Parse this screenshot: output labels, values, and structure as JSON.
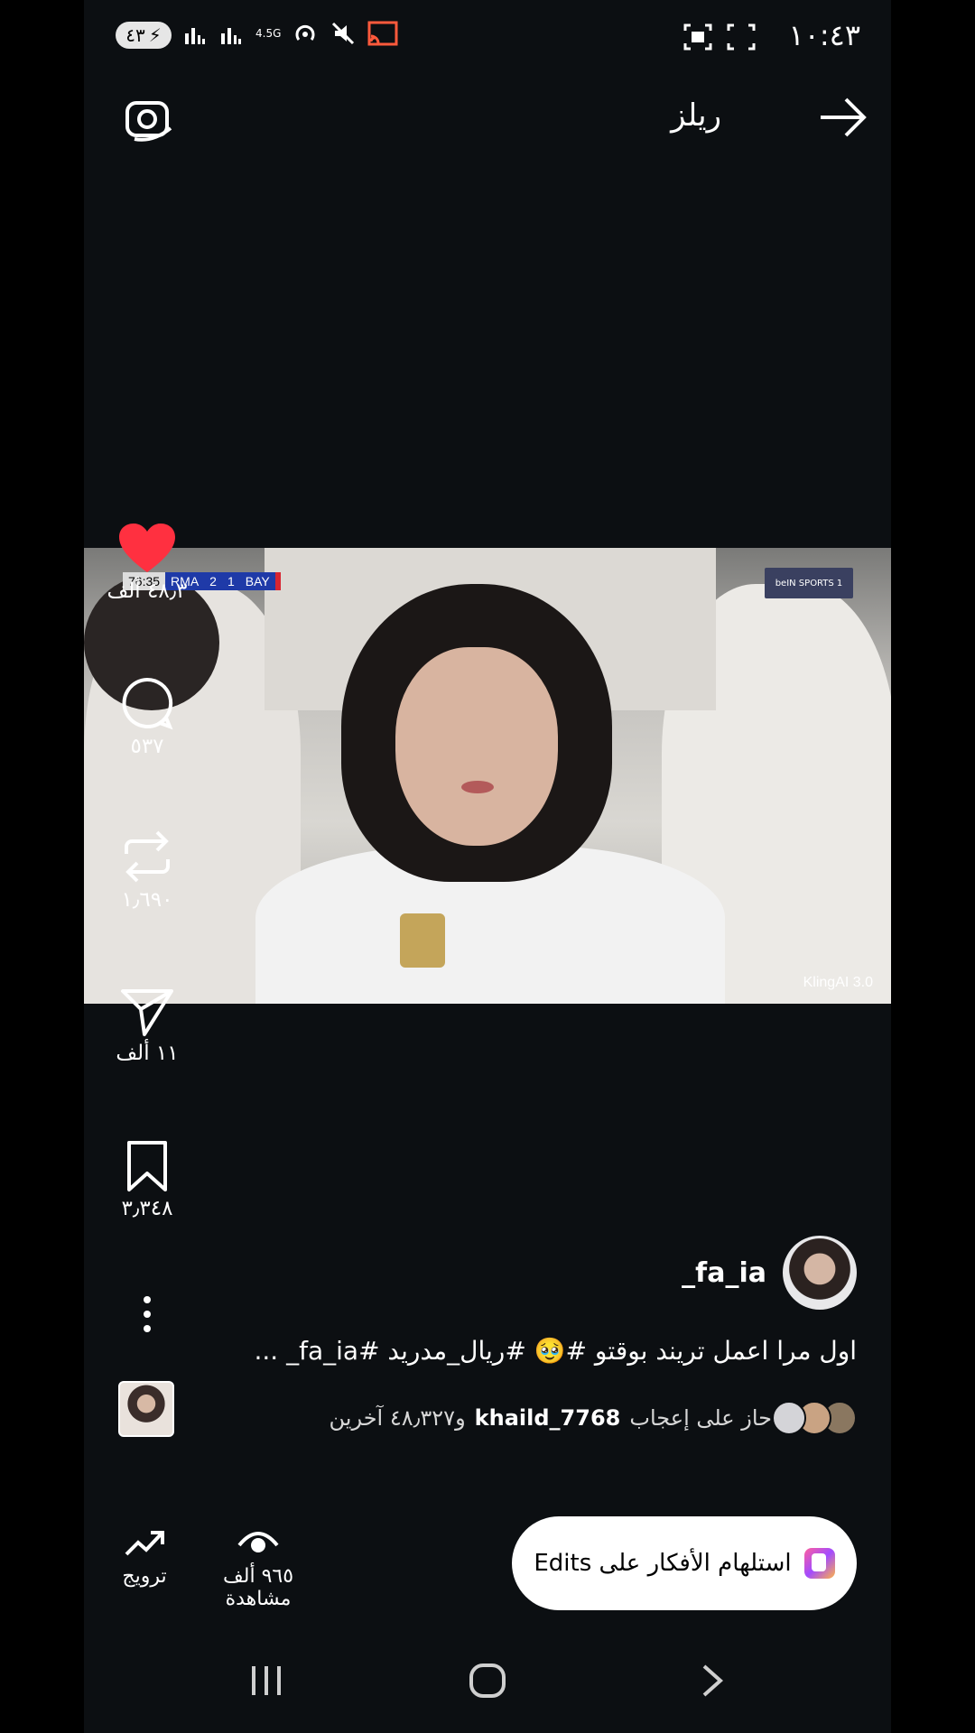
{
  "status_bar": {
    "battery_level": "٤٣",
    "network": "4.5G",
    "time": "١٠:٤٣"
  },
  "header": {
    "title": "ريلز"
  },
  "video": {
    "score": {
      "time": "76:35",
      "home": "RMA",
      "home_score": "2",
      "away_score": "1",
      "away": "BAY"
    },
    "channel_logo_text": "beIN SPORTS 1",
    "watermark": "KlingAI 3.0"
  },
  "actions": {
    "likes": "٤٨٫٣ ألف",
    "comments": "٥٣٧",
    "reposts": "١٫٦٩٠",
    "shares": "١١ ألف",
    "saves": "٣٫٣٤٨"
  },
  "post": {
    "username": "_fa_ia",
    "caption": "اول مرا اعمل تريند بوقتو #🥹 #ريال_مدريد #fa_ia_ ...",
    "likes_prefix": "حاز على إعجاب",
    "likes_user": "khaild_7768",
    "likes_suffix": "و٤٨٫٣٢٧ آخرين"
  },
  "bottom": {
    "promote_label": "ترويج",
    "views_label": "٩٦٥ ألف مشاهدة",
    "edits_label": "استلهام الأفكار على Edits"
  },
  "colors": {
    "background": "#0c0f12",
    "like_red": "#ff3040",
    "pill_bg": "#ffffff"
  }
}
